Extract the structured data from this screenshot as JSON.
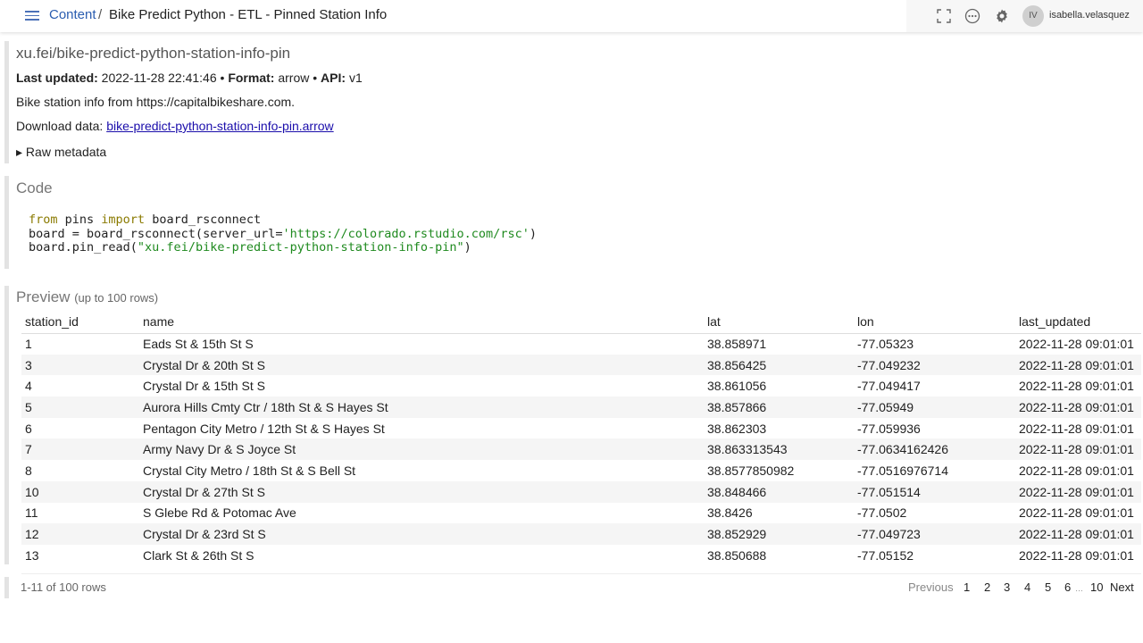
{
  "header": {
    "breadcrumb_link": "Content",
    "separator": "/",
    "title": "Bike Predict Python - ETL - Pinned Station Info",
    "avatar_initials": "IV",
    "username": "isabella.velasquez",
    "icons": [
      "menu-icon",
      "expand-icon",
      "more-icon",
      "gear-icon"
    ]
  },
  "meta": {
    "pin_name": "xu.fei/bike-predict-python-station-info-pin",
    "last_updated_label": "Last updated:",
    "last_updated": "2022-11-28 22:41:46",
    "format_label": "Format:",
    "format": "arrow",
    "api_label": "API:",
    "api": "v1",
    "bullet": "•",
    "description": "Bike station info from https://capitalbikeshare.com.",
    "download_label": "Download data:",
    "download_link": "bike-predict-python-station-info-pin.arrow",
    "raw_metadata": "▸ Raw metadata"
  },
  "code": {
    "title": "Code",
    "line1_kw1": "from",
    "line1_mid": " pins ",
    "line1_kw2": "import",
    "line1_end": " board_rsconnect",
    "line2_start": "board = board_rsconnect(server_url=",
    "line2_str": "'https://colorado.rstudio.com/rsc'",
    "line2_end": ")",
    "line3_start": "board.pin_read(",
    "line3_str": "\"xu.fei/bike-predict-python-station-info-pin\"",
    "line3_end": ")"
  },
  "preview": {
    "title": "Preview",
    "subtitle": "(up to 100 rows)",
    "columns": [
      "station_id",
      "name",
      "lat",
      "lon",
      "last_updated"
    ],
    "rows": [
      [
        "1",
        "Eads St & 15th St S",
        "38.858971",
        "-77.05323",
        "2022-11-28 09:01:01"
      ],
      [
        "3",
        "Crystal Dr & 20th St S",
        "38.856425",
        "-77.049232",
        "2022-11-28 09:01:01"
      ],
      [
        "4",
        "Crystal Dr & 15th St S",
        "38.861056",
        "-77.049417",
        "2022-11-28 09:01:01"
      ],
      [
        "5",
        "Aurora Hills Cmty Ctr / 18th St & S Hayes St",
        "38.857866",
        "-77.05949",
        "2022-11-28 09:01:01"
      ],
      [
        "6",
        "Pentagon City Metro / 12th St & S Hayes St",
        "38.862303",
        "-77.059936",
        "2022-11-28 09:01:01"
      ],
      [
        "7",
        "Army Navy Dr & S Joyce St",
        "38.863313543",
        "-77.0634162426",
        "2022-11-28 09:01:01"
      ],
      [
        "8",
        "Crystal City Metro / 18th St & S Bell St",
        "38.8577850982",
        "-77.0516976714",
        "2022-11-28 09:01:01"
      ],
      [
        "10",
        "Crystal Dr & 27th St S",
        "38.848466",
        "-77.051514",
        "2022-11-28 09:01:01"
      ],
      [
        "11",
        "S Glebe Rd & Potomac Ave",
        "38.8426",
        "-77.0502",
        "2022-11-28 09:01:01"
      ],
      [
        "12",
        "Crystal Dr & 23rd St S",
        "38.852929",
        "-77.049723",
        "2022-11-28 09:01:01"
      ],
      [
        "13",
        "Clark St & 26th St S",
        "38.850688",
        "-77.05152",
        "2022-11-28 09:01:01"
      ]
    ]
  },
  "pager": {
    "rows_info": "1-11 of 100 rows",
    "previous": "Previous",
    "pages": [
      "1",
      "2",
      "3",
      "4",
      "5",
      "6"
    ],
    "ellipsis": "…",
    "last_page": "10",
    "next": "Next"
  }
}
